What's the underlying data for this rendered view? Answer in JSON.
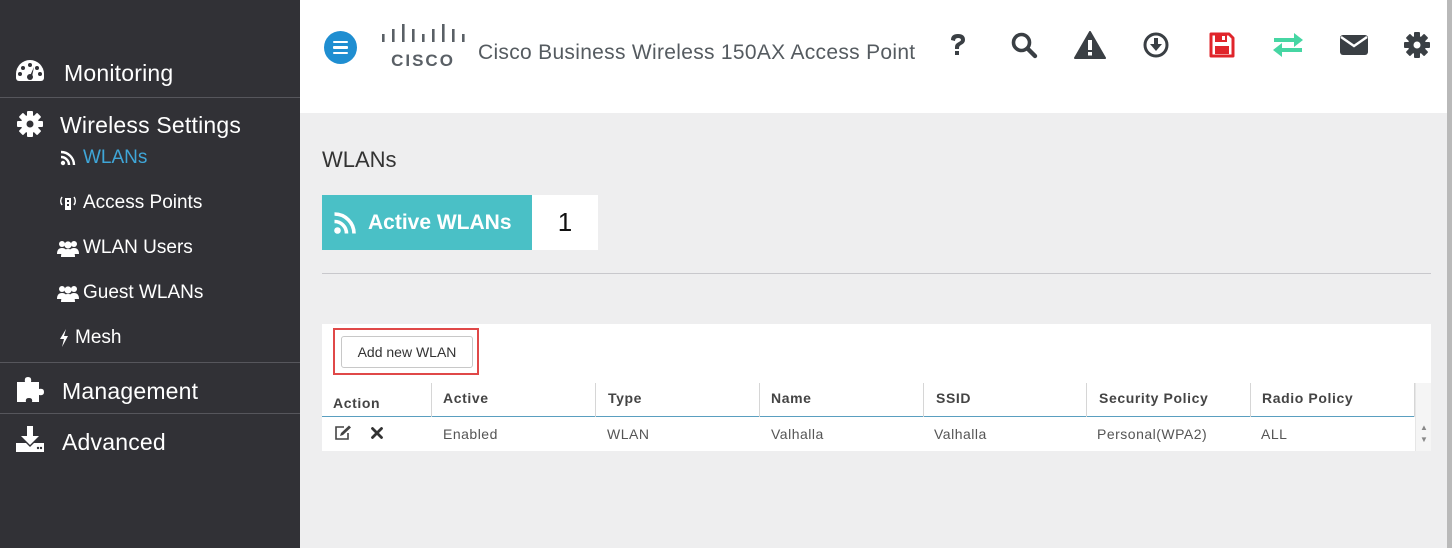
{
  "colors": {
    "sidebar_bg": "#313136",
    "active_link": "#3fa6d8",
    "accent_teal": "#4ac0c6",
    "hamburger_blue": "#1f8ed1",
    "save_icon_red": "#e0252b",
    "sync_icon_green": "#46d6a3",
    "highlight_red": "#e04848"
  },
  "sidebar": {
    "sections": [
      {
        "label": "Monitoring",
        "icon": "dashboard-icon"
      },
      {
        "label": "Wireless Settings",
        "icon": "gear-icon"
      },
      {
        "label": "Management",
        "icon": "puzzle-icon"
      },
      {
        "label": "Advanced",
        "icon": "download-icon"
      }
    ],
    "wireless_items": [
      {
        "label": "WLANs",
        "icon": "rss-icon",
        "active": true
      },
      {
        "label": "Access Points",
        "icon": "access-point-icon"
      },
      {
        "label": "WLAN Users",
        "icon": "users-icon"
      },
      {
        "label": "Guest WLANs",
        "icon": "users-icon"
      },
      {
        "label": "Mesh",
        "icon": "bolt-icon"
      }
    ]
  },
  "header": {
    "logo_text": "CISCO",
    "title": "Cisco Business Wireless 150AX Access Point",
    "icons": [
      "help-icon",
      "search-icon",
      "warning-icon",
      "download-circle-icon",
      "save-icon",
      "sync-icon",
      "mail-icon",
      "settings-icon"
    ]
  },
  "main": {
    "page_title": "WLANs",
    "active_wlans_label": "Active WLANs",
    "active_wlans_count": "1",
    "add_button_label": "Add new WLAN",
    "table": {
      "columns": [
        "Action",
        "Active",
        "Type",
        "Name",
        "SSID",
        "Security Policy",
        "Radio Policy"
      ],
      "rows": [
        {
          "active": "Enabled",
          "type": "WLAN",
          "name": "Valhalla",
          "ssid": "Valhalla",
          "security": "Personal(WPA2)",
          "radio": "ALL"
        }
      ]
    }
  }
}
